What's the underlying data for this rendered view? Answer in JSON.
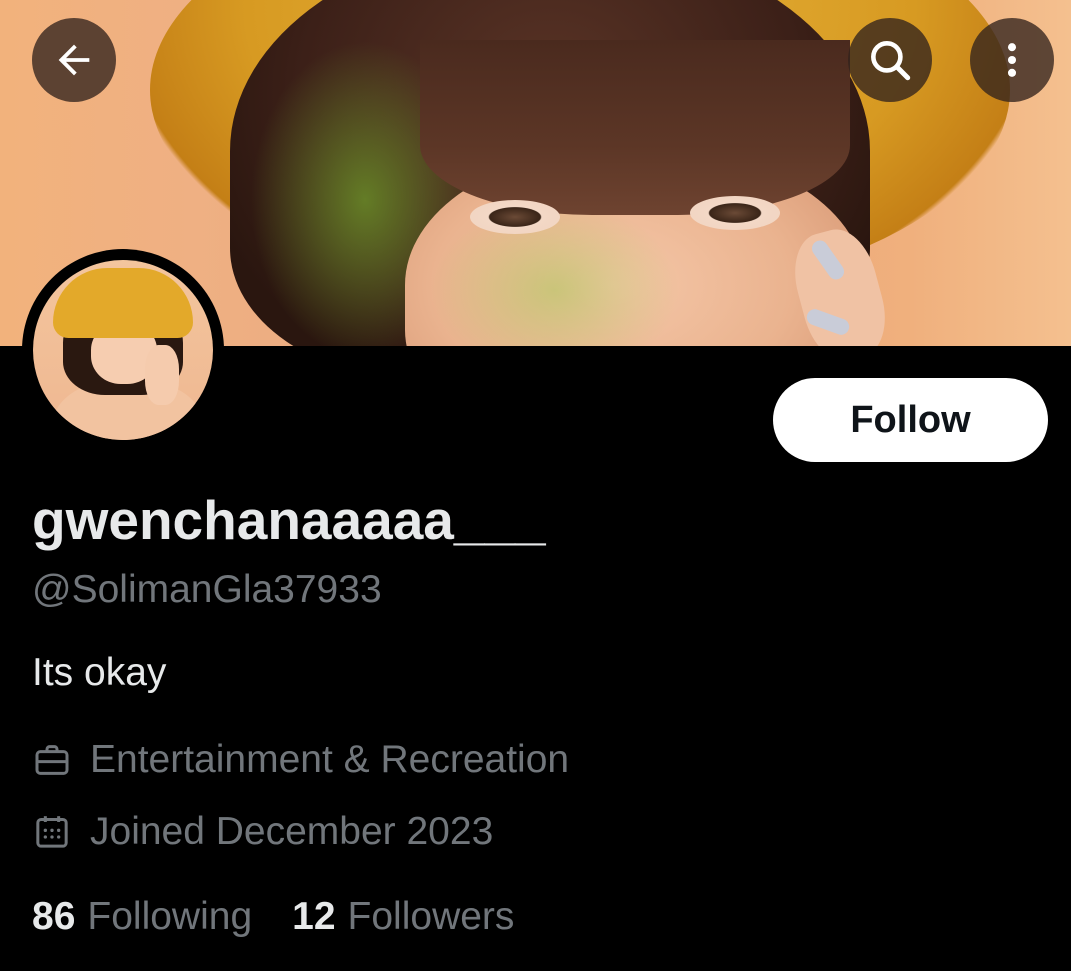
{
  "profile": {
    "display_name": "gwenchanaaaaa___",
    "handle": "@SolimanGla37933",
    "bio": "Its okay",
    "category": "Entertainment & Recreation",
    "joined": "Joined December 2023"
  },
  "actions": {
    "follow_label": "Follow"
  },
  "stats": {
    "following_count": "86",
    "following_label": "Following",
    "followers_count": "12",
    "followers_label": "Followers"
  },
  "icons": {
    "back": "arrow-left-icon",
    "search": "search-icon",
    "more": "more-vertical-icon",
    "category": "briefcase-icon",
    "joined": "calendar-icon"
  },
  "colors": {
    "background": "#000000",
    "primary_text": "#e7e9ea",
    "secondary_text": "#71767b",
    "follow_button_bg": "#ffffff"
  }
}
